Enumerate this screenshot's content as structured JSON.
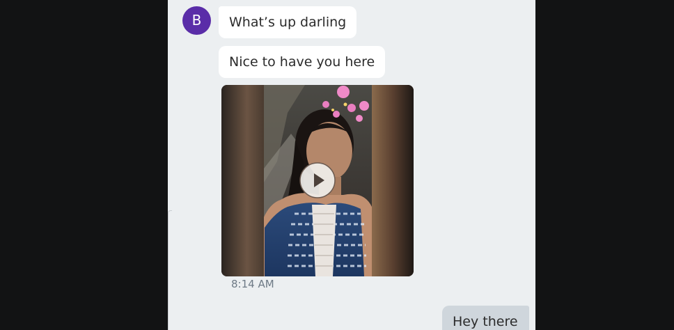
{
  "conversation": {
    "avatar": {
      "initial": "B",
      "color": "#5a2da8"
    },
    "incoming": [
      {
        "text": "What’s up darling"
      },
      {
        "text": "Nice to have you here"
      }
    ],
    "video_message": {
      "icon": "play-icon",
      "timestamp": "8:14 AM"
    },
    "outgoing": [
      {
        "text": "Hey there"
      }
    ]
  },
  "colors": {
    "background": "#121314",
    "panel": "#eceff1",
    "incoming_bubble": "#ffffff",
    "outgoing_bubble": "#cfd6dc",
    "timestamp": "#6e7a86"
  }
}
